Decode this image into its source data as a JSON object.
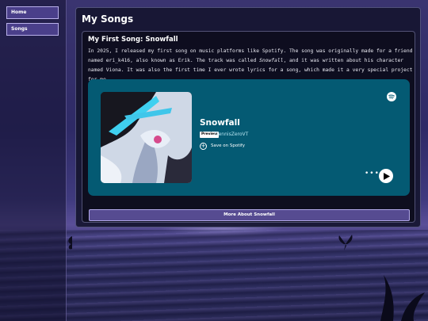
{
  "sidebar": {
    "items": [
      {
        "label": "Home"
      },
      {
        "label": "Songs"
      }
    ]
  },
  "page": {
    "title": "My Songs"
  },
  "song_card": {
    "title": "My First Song: Snowfall",
    "desc_1": "In 2025, I released my first song on music platforms like Spotify. The song was originally made for a friend named eri_k416, also known as Erik. The track was called ",
    "desc_em": "Snowfall",
    "desc_2": ", and it was written about his character named Viona. It was also the first time I ever wrote lyrics for a song, which made it a very special project for me.",
    "more_button": "More About Snowfall"
  },
  "spotify_embed": {
    "song_name": "Snowfall",
    "preview_badge": "Preview",
    "artist": "DennisZeroVT",
    "save_label": "Save on Spotify",
    "more_icon": "•••",
    "icons": {
      "logo": "spotify-icon",
      "save": "plus-circle-icon",
      "play": "play-icon"
    },
    "colors": {
      "background": "#045a73",
      "artist_text": "#b8e6f2"
    }
  },
  "colors": {
    "accent_button": "#564b91",
    "sidebar_button": "#4a3f8a"
  }
}
